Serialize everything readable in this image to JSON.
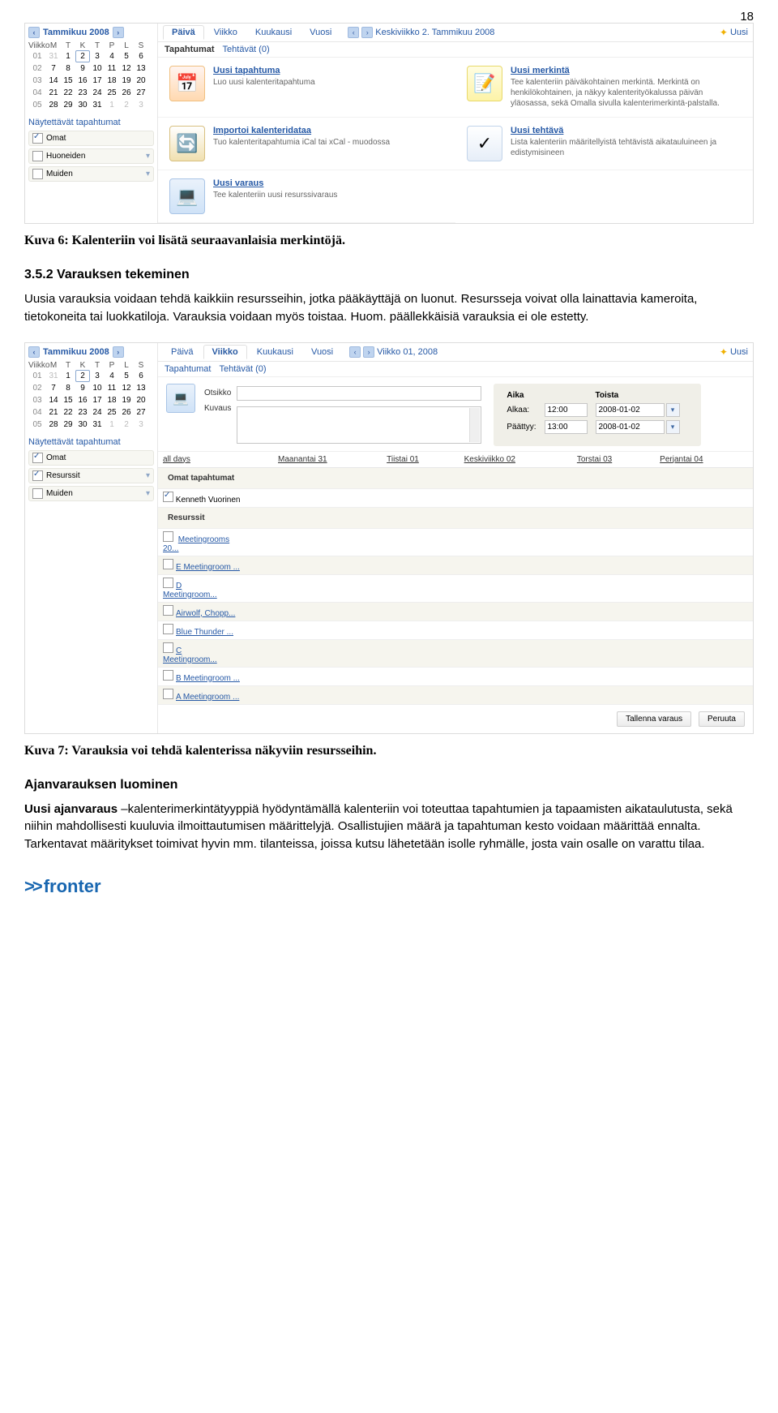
{
  "page_number": "18",
  "fig6": {
    "caption": "Kuva 6: Kalenteriin voi lisätä seuraavanlaisia merkintöjä.",
    "sidebar": {
      "month": "Tammikuu 2008",
      "weekday_header": [
        "Viikko",
        "M",
        "T",
        "K",
        "T",
        "P",
        "L",
        "S"
      ],
      "rows": [
        {
          "wk": "01",
          "days": [
            "31",
            "1",
            "2",
            "3",
            "4",
            "5",
            "6"
          ],
          "dim_first": true,
          "today_index": 2
        },
        {
          "wk": "02",
          "days": [
            "7",
            "8",
            "9",
            "10",
            "11",
            "12",
            "13"
          ]
        },
        {
          "wk": "03",
          "days": [
            "14",
            "15",
            "16",
            "17",
            "18",
            "19",
            "20"
          ]
        },
        {
          "wk": "04",
          "days": [
            "21",
            "22",
            "23",
            "24",
            "25",
            "26",
            "27"
          ]
        },
        {
          "wk": "05",
          "days": [
            "28",
            "29",
            "30",
            "31",
            "1",
            "2",
            "3"
          ],
          "dim_last": 3
        }
      ],
      "section_title": "Näytettävät tapahtumat",
      "items": [
        {
          "label": "Omat",
          "checked": true,
          "dropdown": false
        },
        {
          "label": "Huoneiden",
          "checked": false,
          "dropdown": true
        },
        {
          "label": "Muiden",
          "checked": false,
          "dropdown": true
        }
      ]
    },
    "viewtabs": [
      "Päivä",
      "Viikko",
      "Kuukausi",
      "Vuosi"
    ],
    "active_view": "Päivä",
    "date_display": "Keskiviikko 2. Tammikuu 2008",
    "uusi": "Uusi",
    "subtabs": [
      {
        "label": "Tapahtumat",
        "bold": true
      },
      {
        "label": "Tehtävät (0)",
        "bold": false
      }
    ],
    "panels": [
      {
        "icon": "cal",
        "title": "Uusi tapahtuma",
        "desc": "Luo uusi kalenteritapahtuma"
      },
      {
        "icon": "note",
        "title": "Uusi merkintä",
        "desc": "Tee kalenteriin päiväkohtainen merkintä. Merkintä on henkilökohtainen, ja näkyy kalenterityökalussa päivän yläosassa, sekä Omalla sivulla kalenterimerkintä-palstalla."
      },
      {
        "icon": "imp",
        "title": "Importoi kalenteridataa",
        "desc": "Tuo kalenteritapahtumia iCal tai xCal - muodossa"
      },
      {
        "icon": "task",
        "title": "Uusi tehtävä",
        "desc": "Lista kalenteriin määritellyistä tehtävistä aikatauluineen ja edistymisineen"
      },
      {
        "icon": "lap",
        "title": "Uusi varaus",
        "desc": "Tee kalenteriin uusi resurssivaraus"
      }
    ]
  },
  "section_352": {
    "heading": "3.5.2  Varauksen tekeminen",
    "body": "Uusia varauksia voidaan tehdä kaikkiin resursseihin, jotka pääkäyttäjä on luonut. Resursseja voivat olla lainattavia kameroita, tietokoneita tai luokkatiloja. Varauksia voidaan myös toistaa. Huom. päällekkäisiä varauksia ei ole estetty."
  },
  "fig7": {
    "caption": "Kuva 7: Varauksia voi tehdä kalenterissa näkyviin resursseihin.",
    "sidebar": {
      "month": "Tammikuu 2008",
      "weekday_header": [
        "Viikko",
        "M",
        "T",
        "K",
        "T",
        "P",
        "L",
        "S"
      ],
      "rows": [
        {
          "wk": "01",
          "days": [
            "31",
            "1",
            "2",
            "3",
            "4",
            "5",
            "6"
          ],
          "dim_first": true,
          "today_index": 2
        },
        {
          "wk": "02",
          "days": [
            "7",
            "8",
            "9",
            "10",
            "11",
            "12",
            "13"
          ]
        },
        {
          "wk": "03",
          "days": [
            "14",
            "15",
            "16",
            "17",
            "18",
            "19",
            "20"
          ]
        },
        {
          "wk": "04",
          "days": [
            "21",
            "22",
            "23",
            "24",
            "25",
            "26",
            "27"
          ]
        },
        {
          "wk": "05",
          "days": [
            "28",
            "29",
            "30",
            "31",
            "1",
            "2",
            "3"
          ],
          "dim_last": 3
        }
      ],
      "section_title": "Näytettävät tapahtumat",
      "items": [
        {
          "label": "Omat",
          "checked": true,
          "dropdown": false
        },
        {
          "label": "Resurssit",
          "checked": true,
          "dropdown": true
        },
        {
          "label": "Muiden",
          "checked": false,
          "dropdown": true
        }
      ]
    },
    "viewtabs": [
      "Päivä",
      "Viikko",
      "Kuukausi",
      "Vuosi"
    ],
    "active_view": "Viikko",
    "date_display": "Viikko 01, 2008",
    "uusi": "Uusi",
    "subtabs": [
      {
        "label": "Tapahtumat",
        "bold": false
      },
      {
        "label": "Tehtävät (0)",
        "bold": false
      }
    ],
    "form": {
      "otsikko_label": "Otsikko",
      "kuvaus_label": "Kuvaus",
      "aika_header": "Aika",
      "toista_header": "Toista",
      "alkaa_label": "Alkaa:",
      "paattyy_label": "Päättyy:",
      "t_start": "12:00",
      "d_start": "2008-01-02",
      "t_end": "13:00",
      "d_end": "2008-01-02"
    },
    "grid": {
      "first_col": "all days",
      "day_headers": [
        "Maanantai 31",
        "Tiistai 01",
        "Keskiviikko 02",
        "Torstai 03",
        "Perjantai 04"
      ],
      "own_section": "Omat tapahtumat",
      "own_item": "Kenneth Vuorinen",
      "res_section": "Resurssit",
      "res_group": "Meetingrooms",
      "res_count": "20...",
      "resources": [
        "E Meetingroom ...",
        "D Meetingroom ...",
        "Airwolf, Chopp...",
        "Blue Thunder ...",
        "C Meetingroom ...",
        "B Meetingroom ...",
        "A Meetingroom ..."
      ],
      "multiword": [
        "D",
        "Meetingroom...",
        "C",
        "Meetingroom..."
      ]
    },
    "save_btn": "Tallenna varaus",
    "cancel_btn": "Peruuta"
  },
  "booking": {
    "heading": "Ajanvarauksen luominen",
    "lead": "Uusi ajanvaraus",
    "body": " –kalenterimerkintätyyppiä hyödyntämällä kalenteriin voi toteuttaa tapahtumien ja tapaamisten aikataulutusta, sekä niihin mahdollisesti kuuluvia ilmoittautumisen määrittelyjä. Osallistujien määrä ja tapahtuman kesto voidaan määrittää ennalta. Tarkentavat määritykset toimivat hyvin mm. tilanteissa, joissa kutsu lähetetään isolle ryhmälle, josta vain osalle on varattu tilaa."
  },
  "logo_text": "fronter"
}
